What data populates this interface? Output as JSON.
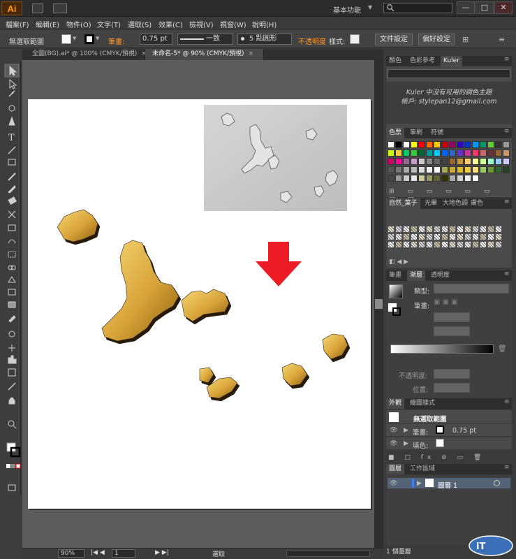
{
  "app": {
    "logo": "Ai",
    "workspace": "基本功能",
    "window_buttons": [
      "—",
      "□",
      "✕"
    ]
  },
  "menu": [
    "檔案(F)",
    "編輯(E)",
    "物件(O)",
    "文字(T)",
    "選取(S)",
    "效果(C)",
    "檢視(V)",
    "視窗(W)",
    "說明(H)"
  ],
  "control": {
    "selection_label": "無選取範圍",
    "stroke_label": "筆畫:",
    "stroke_value": "0.75 pt",
    "stroke_profile": "一致",
    "brush": "5 點圓形",
    "opacity_label": "不透明度",
    "style_label": "樣式:",
    "doc_setup": "文件設定",
    "prefs": "偏好設定"
  },
  "tabs": [
    {
      "label": "全圖(BG).ai* @ 100% (CMYK/預視)",
      "close": "×"
    },
    {
      "label": "未命名-5* @ 90% (CMYK/預視)",
      "close": "×"
    }
  ],
  "status": {
    "zoom": "90%",
    "page": "1",
    "mode": "選取"
  },
  "panels": {
    "color_group": {
      "tabs": [
        "顏色",
        "色彩參考",
        "Kuler"
      ],
      "active": 2
    },
    "kuler": {
      "line1": "Kuler 中沒有可用的調色主題",
      "line2": "帳戶: stylepan12@gmail.com"
    },
    "swatch_group": {
      "tabs": [
        "色票",
        "筆刷",
        "符號"
      ],
      "active": 0
    },
    "pattern_group": {
      "tabs": [
        "自然_葉子",
        "光暈",
        "大地色調",
        "膚色"
      ],
      "active": 0
    },
    "gradient_group": {
      "tabs": [
        "筆畫",
        "漸層",
        "透明度"
      ],
      "active": 1
    },
    "gradient": {
      "type_label": "類型:",
      "stroke_label": "筆畫:",
      "opacity_label": "不透明度:",
      "position_label": "位置:"
    },
    "appearance_group": {
      "tabs": [
        "外觀",
        "繪圖樣式"
      ],
      "active": 0
    },
    "appearance": {
      "title": "無選取範圍",
      "stroke_label": "筆畫:",
      "stroke_value": "0.75 pt",
      "fill_label": "填色:"
    },
    "layers_group": {
      "tabs": [
        "圖層",
        "工作區域"
      ],
      "active": 0
    },
    "layer": {
      "name": "圖層 1"
    },
    "layers_status": "1 個圖層"
  },
  "colors": {
    "gold_light": "#f2cc66",
    "gold_dark": "#9a6a10",
    "arrow_red": "#ed1c24",
    "orange_label": "#ff9a2a"
  },
  "swatches": [
    [
      "#ffffff",
      "#000000",
      "#ffffff",
      "#ffff00",
      "#ff0000",
      "#ff6600",
      "#ffcc00",
      "#cc0000",
      "#990066",
      "#3300cc",
      "#0033cc",
      "#0099ff",
      "#009966",
      "#66cc33",
      "#333333",
      "#999999"
    ],
    [
      "#ccff00",
      "#ffcc33",
      "#00cc66",
      "#33cc33",
      "#006633",
      "#009999",
      "#00ccff",
      "#0066ff",
      "#3366cc",
      "#6633cc",
      "#cc3399",
      "#ff3366",
      "#cc6666",
      "#663333",
      "#996633",
      "#cc9966"
    ],
    [
      "#cc0066",
      "#ff0099",
      "#996699",
      "#cc99cc",
      "#cccccc",
      "#888888",
      "#666666",
      "#444444",
      "#996633",
      "#cc9933",
      "#ffcc66",
      "#ffff99",
      "#ccff99",
      "#99ffcc",
      "#99ccff",
      "#ccccff"
    ],
    [
      "#555555",
      "#777777",
      "#aaaaaa",
      "#bbbbbb",
      "#dddddd",
      "#eeeeee",
      "#ffffff",
      "#aaaa55",
      "#ccaa33",
      "#ddbb22",
      "#eecc44",
      "#ffdd77",
      "#99cc66",
      "#669933",
      "#336633",
      "#224422"
    ],
    [
      "#444444",
      "#999999",
      "#cccccc",
      "#e6e6e6",
      "#cccc99",
      "#999966",
      "#666633",
      "#333300",
      "#aaaaaa",
      "#d2d2d2",
      "#f0f0f0",
      "#ffffff",
      "#ff0000",
      "#ffcc00",
      "#00cc00",
      "#0000ff"
    ]
  ],
  "icons": {
    "search": "search-icon",
    "visibility": "eye-icon"
  }
}
